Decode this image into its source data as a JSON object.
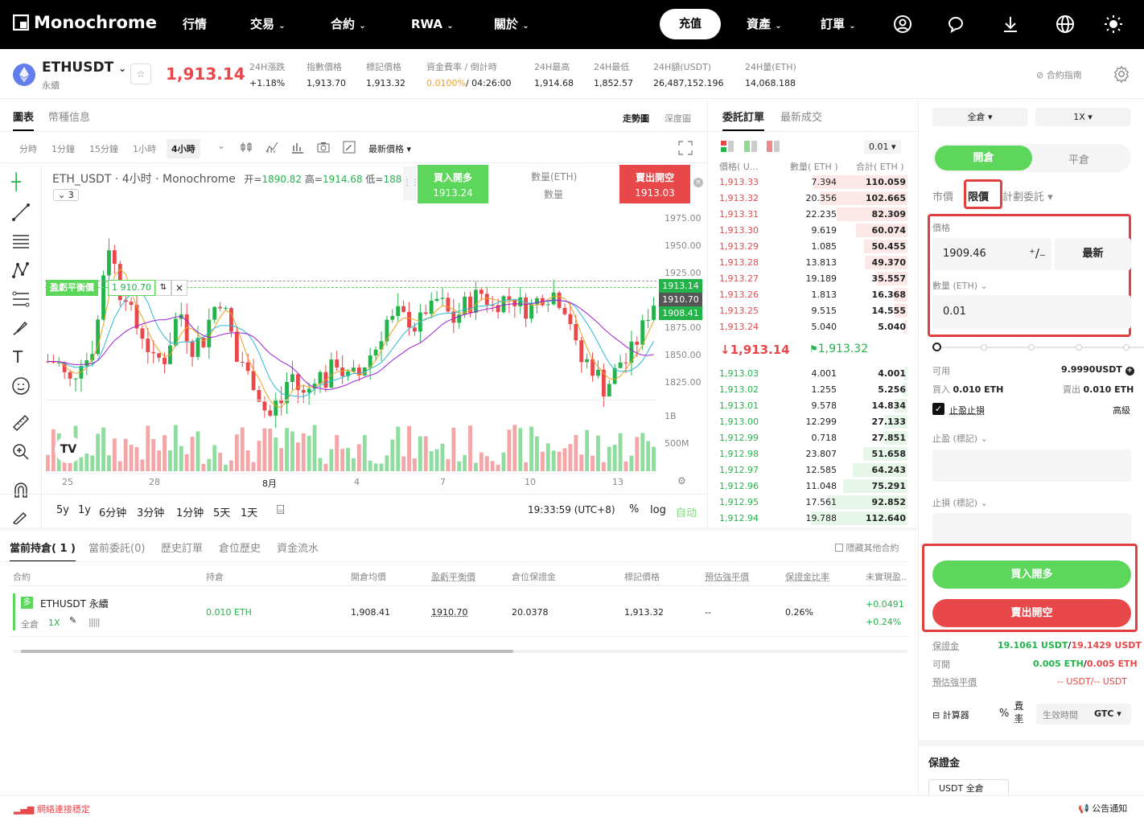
{
  "nav": {
    "brand": "Monochrome",
    "items": [
      "行情",
      "交易",
      "合約",
      "RWA",
      "關於"
    ],
    "deposit": "充值",
    "assets": "資產",
    "orders": "訂單"
  },
  "ticker": {
    "symbol": "ETHUSDT",
    "sub": "永續",
    "last": "1,913.14",
    "stats": [
      {
        "label": "24H漲跌",
        "value": "+1.18%",
        "color": "green"
      },
      {
        "label": "指數價格",
        "value": "1,913.70",
        "color": ""
      },
      {
        "label": "標記價格",
        "value": "1,913.32",
        "color": ""
      },
      {
        "label": "資金費率 / 倒計時",
        "value_a": "0.0100%",
        "value_b": "/ 04:26:00",
        "color": ""
      },
      {
        "label": "24H最高",
        "value": "1,914.68",
        "color": ""
      },
      {
        "label": "24H最低",
        "value": "1,852.57",
        "color": ""
      },
      {
        "label": "24H額(USDT)",
        "value": "26,487,152.196",
        "color": ""
      },
      {
        "label": "24H量(ETH)",
        "value": "14,068.188",
        "color": ""
      }
    ],
    "guide": "合約指南"
  },
  "chart": {
    "tabs": [
      "圖表",
      "幣種信息"
    ],
    "view_tabs": [
      "走勢圖",
      "深度圖"
    ],
    "intervals": [
      "分時",
      "1分鐘",
      "15分鐘",
      "1小時",
      "4小時"
    ],
    "price_type": "最新價格",
    "legend": "ETH_USDT · 4小时 · Monochrome",
    "ohlc_o_label": "开=",
    "ohlc_o": "1890.82",
    "ohlc_h_label": "高=",
    "ohlc_h": "1914.68",
    "ohlc_l_label": "低=",
    "ohlc_l": "188",
    "indicator_count": "3",
    "buy_long": "買入開多",
    "buy_price": "1913.24",
    "qty_label": "數量(ETH)",
    "qty_sub": "數量",
    "sell_short": "賣出開空",
    "sell_price": "1913.03",
    "breakeven_label": "盈虧平衡價",
    "breakeven_value": "1 910.70",
    "price_axis": [
      "1975.00",
      "1950.00",
      "1925.00",
      "1875.00",
      "1850.00",
      "1825.00"
    ],
    "vol_axis": [
      "1B",
      "500M"
    ],
    "tag_last": "1913.14",
    "tag_be": "1910.70",
    "tag_entry": "1908.41",
    "time_axis": [
      "25",
      "28",
      "8月",
      "4",
      "7",
      "10",
      "13"
    ],
    "ranges": [
      "5y",
      "1y",
      "6分钟",
      "3分钟",
      "1分钟",
      "5天",
      "1天"
    ],
    "clock": "19:33:59 (UTC+8)",
    "pct": "%",
    "log": "log",
    "auto": "自动"
  },
  "book": {
    "tabs": [
      "委託訂單",
      "最新成交"
    ],
    "precision": "0.01",
    "headers": [
      "價格( U...",
      "數量( ETH )",
      "合計( ETH )"
    ],
    "asks": [
      [
        "1,913.33",
        "7.394",
        "110.059"
      ],
      [
        "1,913.32",
        "20.356",
        "102.665"
      ],
      [
        "1,913.31",
        "22.235",
        "82.309"
      ],
      [
        "1,913.30",
        "9.619",
        "60.074"
      ],
      [
        "1,913.29",
        "1.085",
        "50.455"
      ],
      [
        "1,913.28",
        "13.813",
        "49.370"
      ],
      [
        "1,913.27",
        "19.189",
        "35.557"
      ],
      [
        "1,913.26",
        "1.813",
        "16.368"
      ],
      [
        "1,913.25",
        "9.515",
        "14.555"
      ],
      [
        "1,913.24",
        "5.040",
        "5.040"
      ]
    ],
    "mid_price": "1,913.14",
    "mark_price": "1,913.32",
    "bids": [
      [
        "1,913.03",
        "4.001",
        "4.001"
      ],
      [
        "1,913.02",
        "1.255",
        "5.256"
      ],
      [
        "1,913.01",
        "9.578",
        "14.834"
      ],
      [
        "1,913.00",
        "12.299",
        "27.133"
      ],
      [
        "1,912.99",
        "0.718",
        "27.851"
      ],
      [
        "1,912.98",
        "23.807",
        "51.658"
      ],
      [
        "1,912.97",
        "12.585",
        "64.243"
      ],
      [
        "1,912.96",
        "11.048",
        "75.291"
      ],
      [
        "1,912.95",
        "17.561",
        "92.852"
      ],
      [
        "1,912.94",
        "19.788",
        "112.640"
      ]
    ]
  },
  "order": {
    "margin_mode": "全倉",
    "leverage": "1X",
    "open_tab": "開倉",
    "close_tab": "平倉",
    "type_market": "市價",
    "type_limit": "限價",
    "type_plan": "計劃委託",
    "price_label": "價格",
    "price_value": "1909.46",
    "latest": "最新",
    "qty_label": "數量 (ETH)",
    "qty_value": "0.01",
    "available_label": "可用",
    "available_value": "9.9990USDT",
    "buy_label": "買入",
    "buy_value": "0.010 ETH",
    "sell_label": "賣出",
    "sell_value": "0.010 ETH",
    "tpsl_label": "止盈止損",
    "advanced": "高級",
    "tp_label": "止盈 (標記)",
    "sl_label": "止損 (標記)",
    "buy_btn": "買入開多",
    "sell_btn": "賣出開空",
    "margin_label": "保證金",
    "margin_buy": "19.1061 USDT",
    "margin_sep": "/",
    "margin_sell": "19.1429 USDT",
    "avail_label2": "可開",
    "avail_buy": "0.005 ETH",
    "avail_sell": "0.005 ETH",
    "liq_label": "預估強平價",
    "liq_value": "-- USDT/-- USDT",
    "calculator": "計算器",
    "fee_a": "費",
    "fee_b": "率",
    "tif_label": "生效時間",
    "tif_value": "GTC",
    "margin_section": "保證金",
    "margin_asset": "USDT 全倉"
  },
  "positions": {
    "tabs": [
      "當前持倉( 1 )",
      "當前委託(0)",
      "歷史訂單",
      "倉位歷史",
      "資金流水"
    ],
    "hide_others": "隱藏其他合約",
    "headers": [
      "合約",
      "持倉",
      "開倉均價",
      "盈虧平衡價",
      "倉位保證金",
      "標記價格",
      "預估強平價",
      "保證金比率",
      "未實現盈..."
    ],
    "row": {
      "side": "多",
      "symbol": "ETHUSDT 永續",
      "mode": "全倉",
      "lev": "1X",
      "size": "0.010 ETH",
      "entry": "1,908.41",
      "breakeven": "1910.70",
      "margin": "20.0378",
      "mark": "1,913.32",
      "liq": "--",
      "ratio": "0.26%",
      "pnl": "+0.0491",
      "pnl_pct": "+0.24%"
    }
  },
  "status": {
    "network": "網絡連接穩定",
    "announcement": "公告通知"
  },
  "colors": {
    "up": "#24b34b",
    "down": "#e8484a",
    "accent_green": "#5cd75c",
    "accent_red": "#e8484a"
  }
}
